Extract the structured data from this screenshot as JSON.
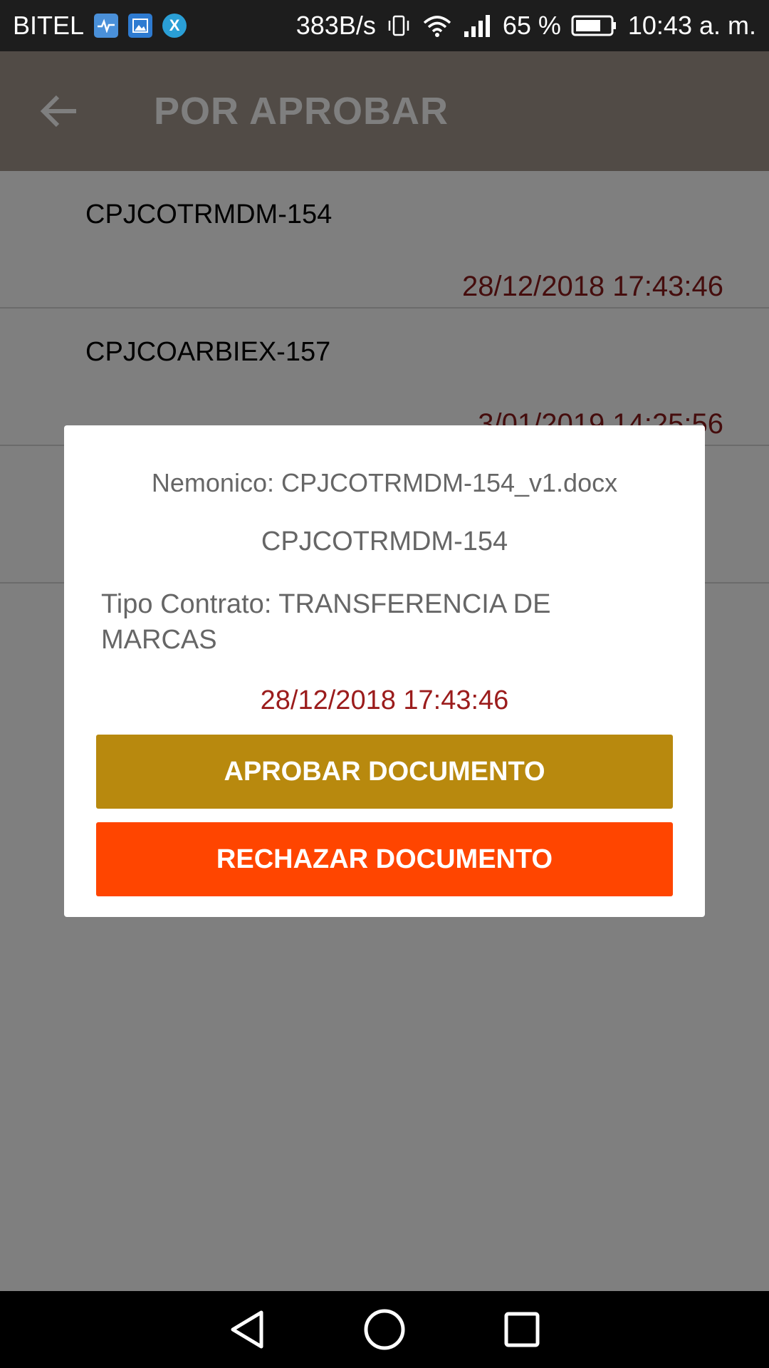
{
  "status_bar": {
    "carrier": "BITEL",
    "net_speed": "383B/s",
    "battery": "65 %",
    "time": "10:43 a. m.",
    "icons": [
      "health-app-icon",
      "gallery-app-icon",
      "x-app-icon",
      "vibrate-icon",
      "wifi-icon",
      "signal-icon",
      "battery-icon"
    ]
  },
  "app_bar": {
    "title": "POR APROBAR",
    "back_icon": "arrow-back-icon",
    "color": "#a3978d"
  },
  "list": {
    "items": [
      {
        "code": "CPJCOTRMDM-154",
        "date": "28/12/2018 17:43:46"
      },
      {
        "code": "CPJCOARBIEX-157",
        "date": "3/01/2019 14:25:56"
      },
      {
        "code": "",
        "date": ""
      }
    ]
  },
  "dialog": {
    "nemonico": "Nemonico: CPJCOTRMDM-154_v1.docx",
    "code": "CPJCOTRMDM-154",
    "tipo_contrato": "Tipo Contrato: TRANSFERENCIA DE MARCAS",
    "date": "28/12/2018 17:43:46",
    "approve_label": "APROBAR DOCUMENTO",
    "reject_label": "RECHAZAR DOCUMENTO",
    "approve_color": "#b8890e",
    "reject_color": "#ff4500",
    "date_color": "#9b1c1c"
  },
  "nav_bar": {
    "icons": [
      "back-triangle-icon",
      "home-circle-icon",
      "recents-square-icon"
    ]
  }
}
